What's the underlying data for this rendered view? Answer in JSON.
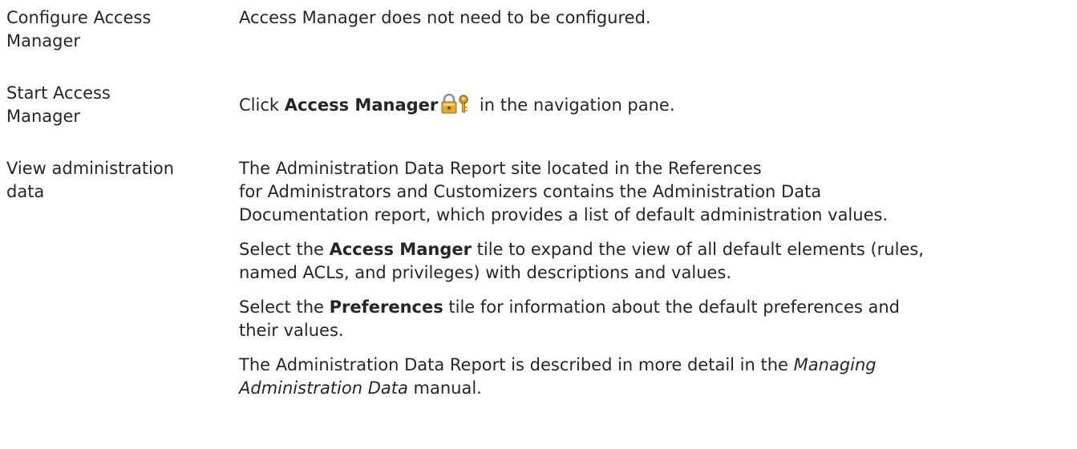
{
  "rows": [
    {
      "label": [
        "Configure Access",
        "Manager"
      ],
      "text": "Access Manager does not need to be configured."
    },
    {
      "label": [
        "Start Access",
        "Manager"
      ],
      "before": "Click ",
      "bold": "Access Manager",
      "icon": "padlock-key-icon",
      "after": " in the navigation pane."
    },
    {
      "label": [
        "View administration",
        "data"
      ],
      "intro": [
        "The Administration Data Report site located in the References",
        "for Administrators and Customizers contains the Administration Data",
        "Documentation report, which provides a list of default administration values."
      ],
      "access": {
        "line1_before": "Select the ",
        "line1_bold": "Access Manger",
        "line1_after": " tile to expand the view of all default elements (rules,",
        "line2": "named ACLs, and privileges) with descriptions and values."
      },
      "prefs": {
        "line1_before": "Select the ",
        "line1_bold": "Preferences",
        "line1_after": " tile for information about the default preferences and",
        "line2": "their values."
      },
      "report": {
        "line1_before": "The Administration Data Report is described in more detail in the ",
        "line1_italic": "Managing",
        "line2_italic": "Administration Data",
        "line2_after": " manual."
      }
    }
  ]
}
